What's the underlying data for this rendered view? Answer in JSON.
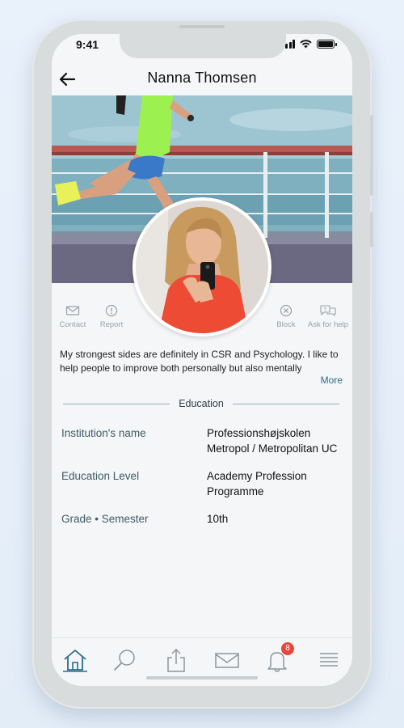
{
  "status_bar": {
    "time": "9:41"
  },
  "header": {
    "title": "Nanna Thomsen"
  },
  "actions": [
    {
      "label": "Contact"
    },
    {
      "label": "Report"
    },
    {
      "label": "Block"
    },
    {
      "label": "Ask for help"
    }
  ],
  "bio": {
    "text": "My strongest sides are definitely in CSR and Psychology. I like to help people to improve both personally but also mentally",
    "more_label": "More"
  },
  "education": {
    "heading": "Education",
    "rows": [
      {
        "label": "Institution's name",
        "value": "Professionshøjskolen Metropol / Metropolitan UC"
      },
      {
        "label": "Education Level",
        "value": "Academy Profession Programme"
      },
      {
        "label": "Grade • Semester",
        "value": "10th"
      }
    ]
  },
  "tabbar": {
    "notifications_count": "8"
  },
  "colors": {
    "accent": "#2a6d8a",
    "badge": "#e8463c",
    "icon_gray": "#9aa1a8"
  }
}
